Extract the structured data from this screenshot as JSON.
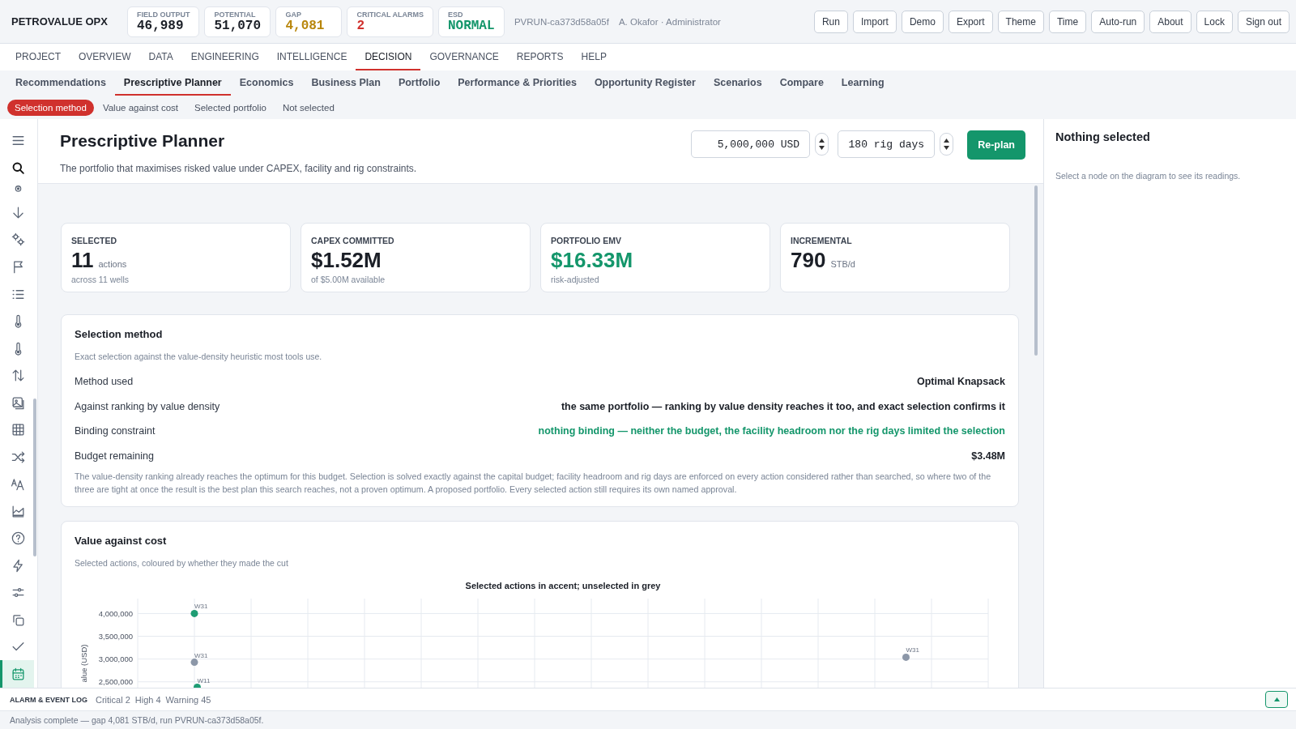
{
  "app": {
    "brand": "PETROVALUE OPX"
  },
  "kpis": [
    {
      "label": "FIELD OUTPUT",
      "value": "46,989",
      "color": "#1b1f27"
    },
    {
      "label": "POTENTIAL",
      "value": "51,070",
      "color": "#1b1f27"
    },
    {
      "label": "GAP",
      "value": "4,081",
      "color": "#b8860b"
    },
    {
      "label": "CRITICAL ALARMS",
      "value": "2",
      "color": "#d0312d"
    },
    {
      "label": "ESD",
      "value": "NORMAL",
      "color": "#14966b"
    }
  ],
  "run_id": "PVRUN-ca373d58a05f",
  "user": "A. Okafor · Administrator",
  "actions": [
    "Run",
    "Import",
    "Demo",
    "Export",
    "Theme",
    "Time",
    "Auto-run",
    "About",
    "Lock",
    "Sign out"
  ],
  "nav": [
    {
      "label": "PROJECT",
      "selected": false
    },
    {
      "label": "OVERVIEW",
      "selected": false
    },
    {
      "label": "DATA",
      "selected": false
    },
    {
      "label": "ENGINEERING",
      "selected": false
    },
    {
      "label": "INTELLIGENCE",
      "selected": false
    },
    {
      "label": "DECISION",
      "selected": true
    },
    {
      "label": "GOVERNANCE",
      "selected": false
    },
    {
      "label": "REPORTS",
      "selected": false
    },
    {
      "label": "HELP",
      "selected": false
    }
  ],
  "subtabs": [
    {
      "label": "Recommendations",
      "selected": false
    },
    {
      "label": "Prescriptive Planner",
      "selected": true
    },
    {
      "label": "Economics",
      "selected": false
    },
    {
      "label": "Business Plan",
      "selected": false
    },
    {
      "label": "Portfolio",
      "selected": false
    },
    {
      "label": "Performance & Priorities",
      "selected": false
    },
    {
      "label": "Opportunity Register",
      "selected": false
    },
    {
      "label": "Scenarios",
      "selected": false
    },
    {
      "label": "Compare",
      "selected": false
    },
    {
      "label": "Learning",
      "selected": false
    }
  ],
  "sections": [
    {
      "label": "Selection method",
      "selected": true
    },
    {
      "label": "Value against cost",
      "selected": false
    },
    {
      "label": "Selected portfolio",
      "selected": false
    },
    {
      "label": "Not selected",
      "selected": false
    }
  ],
  "sidebar": {
    "items": [
      {
        "selected": false
      },
      {
        "selected": false
      },
      {
        "selected": false
      },
      {
        "selected": false
      },
      {
        "selected": false
      },
      {
        "selected": false
      },
      {
        "selected": false
      },
      {
        "selected": false
      },
      {
        "selected": false
      },
      {
        "selected": false
      },
      {
        "selected": false
      },
      {
        "selected": false
      },
      {
        "selected": false
      },
      {
        "selected": false
      },
      {
        "selected": false
      },
      {
        "selected": false
      },
      {
        "selected": false
      },
      {
        "selected": false
      },
      {
        "selected": false
      },
      {
        "selected": false
      },
      {
        "selected": true
      }
    ]
  },
  "planner": {
    "title": "Prescriptive Planner",
    "subtitle": "The portfolio that maximises risked value under CAPEX, facility and rig constraints.",
    "budget": {
      "value": "5,000,000 USD"
    },
    "rig_days": {
      "value": "180 rig days"
    },
    "replan": "Re-plan"
  },
  "cards": [
    {
      "label": "SELECTED",
      "value": "11",
      "unit": "actions",
      "note": "across 11 wells",
      "color": "#1b1f27"
    },
    {
      "label": "CAPEX COMMITTED",
      "value": "$1.52M",
      "note": "of $5.00M available",
      "color": "#1b1f27"
    },
    {
      "label": "PORTFOLIO EMV",
      "value": "$16.33M",
      "note": "risk-adjusted",
      "color": "#14966b"
    },
    {
      "label": "INCREMENTAL",
      "value": "790",
      "unit": "STB/d",
      "color": "#1b1f27"
    }
  ],
  "selection": {
    "title": "Selection method",
    "subtitle": "Exact selection against the value-density heuristic most tools use.",
    "rows": [
      {
        "label": "Method used",
        "value": "Optimal Knapsack",
        "kind": "plain"
      },
      {
        "label": "Against ranking by value density",
        "value": "the same portfolio — ranking by value density reaches it too, and exact selection confirms it",
        "kind": "plain"
      },
      {
        "label": "Binding constraint",
        "value": "nothing binding — neither the budget, the facility headroom nor the rig days limited the selection",
        "kind": "positive"
      },
      {
        "label": "Budget remaining",
        "value": "$3.48M",
        "kind": "plain"
      }
    ],
    "note": "The value-density ranking already reaches the optimum for this budget.  Selection is solved exactly against the capital budget; facility headroom and rig days are enforced on every action considered rather than searched, so where two of the three are tight at once the result is the best plan this search reaches, not a proven optimum.  A proposed portfolio. Every selected action still requires its own named approval."
  },
  "value_chart": {
    "title": "Value against cost",
    "subtitle": "Selected actions, coloured by whether they made the cut",
    "plot": {
      "kind": "scatter",
      "title": "Selected actions in accent; unselected in grey",
      "axis_title": "alue (USD)",
      "ticks": [
        "4,000,000",
        "3,500,000",
        "3,000,000",
        "2,500,000"
      ],
      "points": [
        {
          "label": "W31",
          "selected": true
        },
        {
          "label": "W31",
          "selected": false
        },
        {
          "label": "W31",
          "selected": false
        },
        {
          "label": "W11",
          "selected": true
        }
      ]
    }
  },
  "inspector": {
    "title": "Nothing selected",
    "hint": "Select a node on the diagram to see its readings."
  },
  "alarm_log": {
    "title": "ALARM & EVENT LOG",
    "counts": [
      "Critical 2",
      "High 4",
      "Warning 45"
    ]
  },
  "status_bar": "Analysis complete — gap 4,081 STB/d, run PVRUN-ca373d58a05f."
}
